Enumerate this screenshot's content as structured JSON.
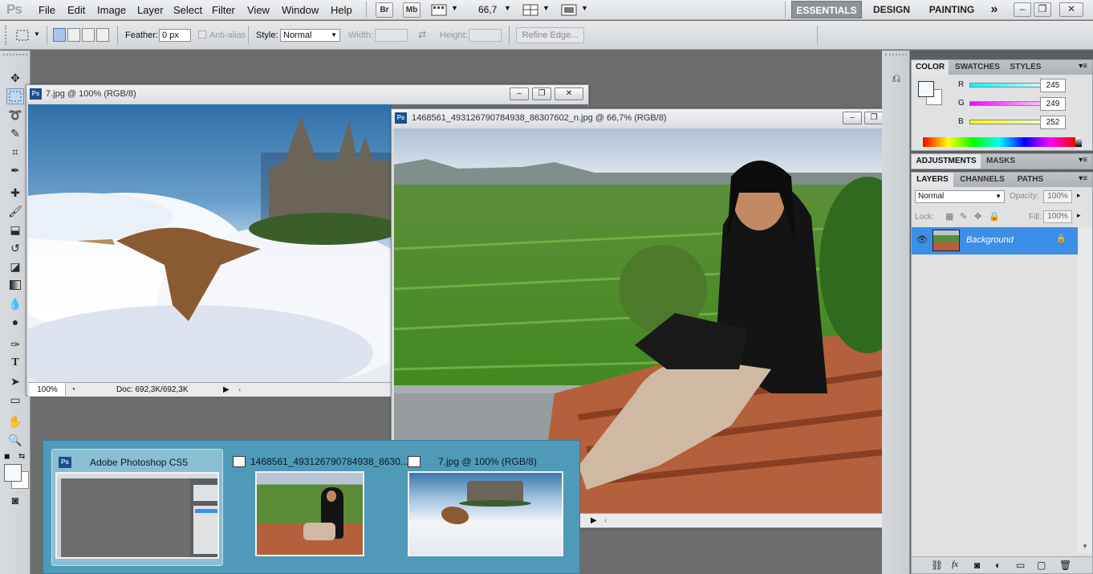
{
  "app": {
    "logo": "Ps",
    "menus": [
      "File",
      "Edit",
      "Image",
      "Layer",
      "Select",
      "Filter",
      "View",
      "Window",
      "Help"
    ],
    "bridge_btn": "Br",
    "minibridge_btn": "Mb",
    "zoom_value": "66,7",
    "workspaces": [
      "ESSENTIALS",
      "DESIGN",
      "PAINTING"
    ],
    "more_workspaces": "»"
  },
  "options": {
    "feather_label": "Feather:",
    "feather_value": "0 px",
    "antialias_label": "Anti-alias",
    "style_label": "Style:",
    "style_value": "Normal",
    "width_label": "Width:",
    "height_label": "Height:",
    "refine_edge": "Refine Edge..."
  },
  "doc1": {
    "title": "7.jpg @ 100% (RGB/8)",
    "zoom": "100%",
    "doc_info": "Doc: 692,3K/692,3K"
  },
  "doc2": {
    "title": "1468561_493126790784938_86307602_n.jpg @ 66,7% (RGB/8)"
  },
  "color_panel": {
    "tabs": [
      "COLOR",
      "SWATCHES",
      "STYLES"
    ],
    "r_label": "R",
    "g_label": "G",
    "b_label": "B",
    "r": "245",
    "g": "249",
    "b": "252"
  },
  "adjust_panel": {
    "tabs": [
      "ADJUSTMENTS",
      "MASKS"
    ]
  },
  "layers_panel": {
    "tabs": [
      "LAYERS",
      "CHANNELS",
      "PATHS"
    ],
    "blend_mode": "Normal",
    "opacity_label": "Opacity:",
    "opacity": "100%",
    "lock_label": "Lock:",
    "fill_label": "Fill:",
    "fill": "100%",
    "layer_name": "Background"
  },
  "taskbar": {
    "items": [
      {
        "title": "Adobe Photoshop CS5"
      },
      {
        "title": "1468561_493126790784938_8630..."
      },
      {
        "title": "7.jpg @ 100% (RGB/8)"
      }
    ]
  },
  "colors": {
    "accent_blue": "#3d8ee6",
    "taskbar_bg": "#4f9ab8"
  }
}
